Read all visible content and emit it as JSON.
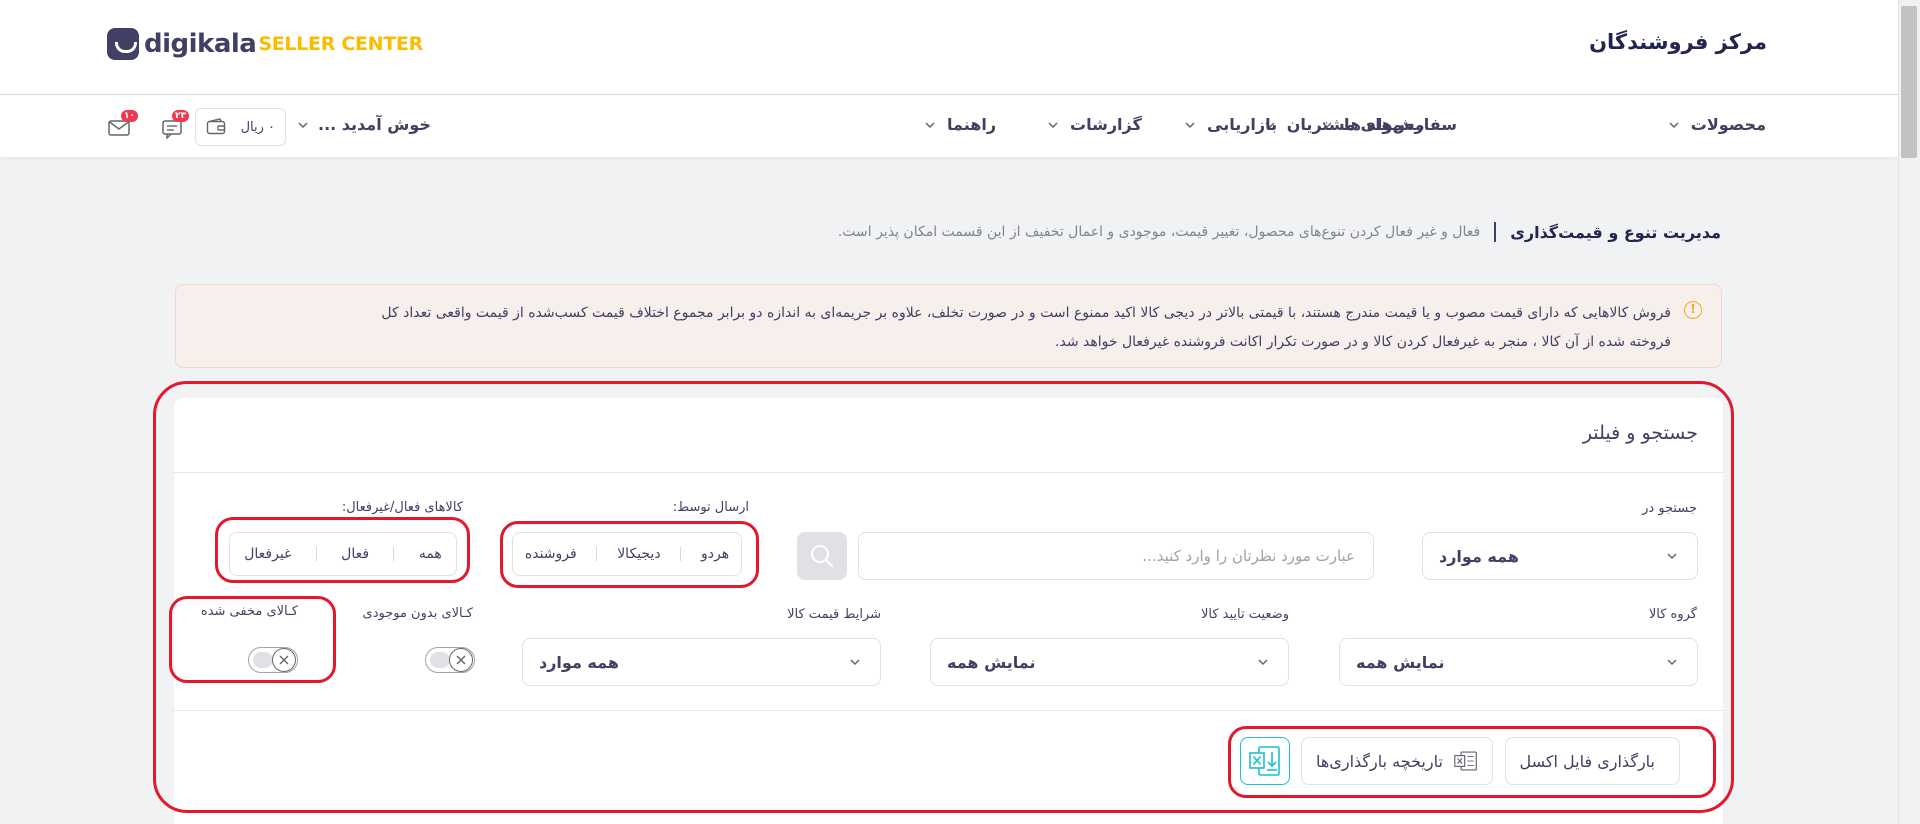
{
  "header": {
    "portal_title": "مرکز فروشندگان",
    "logo_word": "digikala",
    "logo_sub": "SELLER CENTER"
  },
  "nav": {
    "items": [
      {
        "label": "محصولات"
      },
      {
        "label": "سفارش‌های مشتریان"
      },
      {
        "label": "محموله ها"
      },
      {
        "label": "بازاریابی"
      },
      {
        "label": "گزارشات"
      },
      {
        "label": "راهنما"
      }
    ],
    "welcome": "خوش آمدید ...",
    "wallet_amount": "۰ ریال",
    "messages_badge": "۲۳",
    "mail_badge": "۱۰"
  },
  "page": {
    "title": "مدیریت تنوع و قیمت‌گذاری",
    "description": "فعال و غیر فعال کردن تنوع‌های محصول، تغییر قیمت، موجودی و اعمال تخفیف از این قسمت امکان پذیر است."
  },
  "alert": {
    "line1": "فروش کالاهایی که دارای قیمت مصوب و یا قیمت مندرج هستند، با قیمتی بالاتر در دیجی کالا اکید ممنوع است و در صورت تخلف، علاوه بر جریمه‌ای به اندازه دو برابر مجموع اختلاف قیمت کسب‌شده از قیمت واقعی تعداد کل",
    "line2": "فروخته شده از آن کالا ، منجر به غیرفعال کردن کالا و در صورت تکرار اکانت فروشنده غیرفعال خواهد شد."
  },
  "filter": {
    "title": "جستجو و فیلتر",
    "search_in_label": "جستجو در",
    "search_in_value": "همه موارد",
    "search_placeholder": "عبارت مورد نظرتان را وارد کنید...",
    "shipped_by_label": "ارسال توسط:",
    "shipped_by_options": [
      "هردو",
      "دیجیکالا",
      "فروشنده"
    ],
    "active_label": "کالاهای فعال/غیرفعال:",
    "active_options": [
      "همه",
      "فعال",
      "غیرفعال"
    ],
    "group_label": "گروه کالا",
    "group_value": "نمایش همه",
    "approval_label": "وضعیت تایید کالا",
    "approval_value": "نمایش همه",
    "price_label": "شرایط قیمت کالا",
    "price_value": "همه موارد",
    "no_stock_label": "کـالای بدون موجودی",
    "hidden_label": "کـالای مخفی شده",
    "upload_excel": "بارگذاری فایل اکسل",
    "upload_history": "تاریخچه بارگذاری‌ها"
  },
  "colors": {
    "accent": "#19bfd3",
    "annotation": "#e3182c",
    "brand_yellow": "#f9bc00",
    "badge_red": "#ef394e"
  }
}
